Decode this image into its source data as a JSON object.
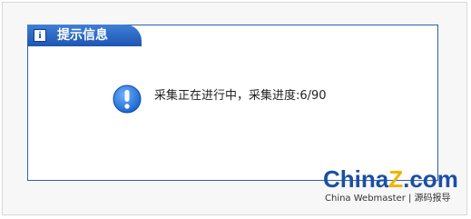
{
  "dialog": {
    "title": "提示信息",
    "info_icon": "info-icon",
    "message": "采集正在进行中，采集进度:6/90",
    "alert_icon": "exclamation-icon",
    "progress": {
      "current": 6,
      "total": 90
    }
  },
  "watermark": {
    "logo_part1": "China",
    "logo_part2": "Z",
    "logo_part3": ".com",
    "subtitle": "China Webmaster | 源码报导"
  },
  "colors": {
    "accent": "#1e56b3",
    "border": "#2f5fa8",
    "logo_blue": "#1b4fa3",
    "logo_yellow": "#f0b400"
  }
}
